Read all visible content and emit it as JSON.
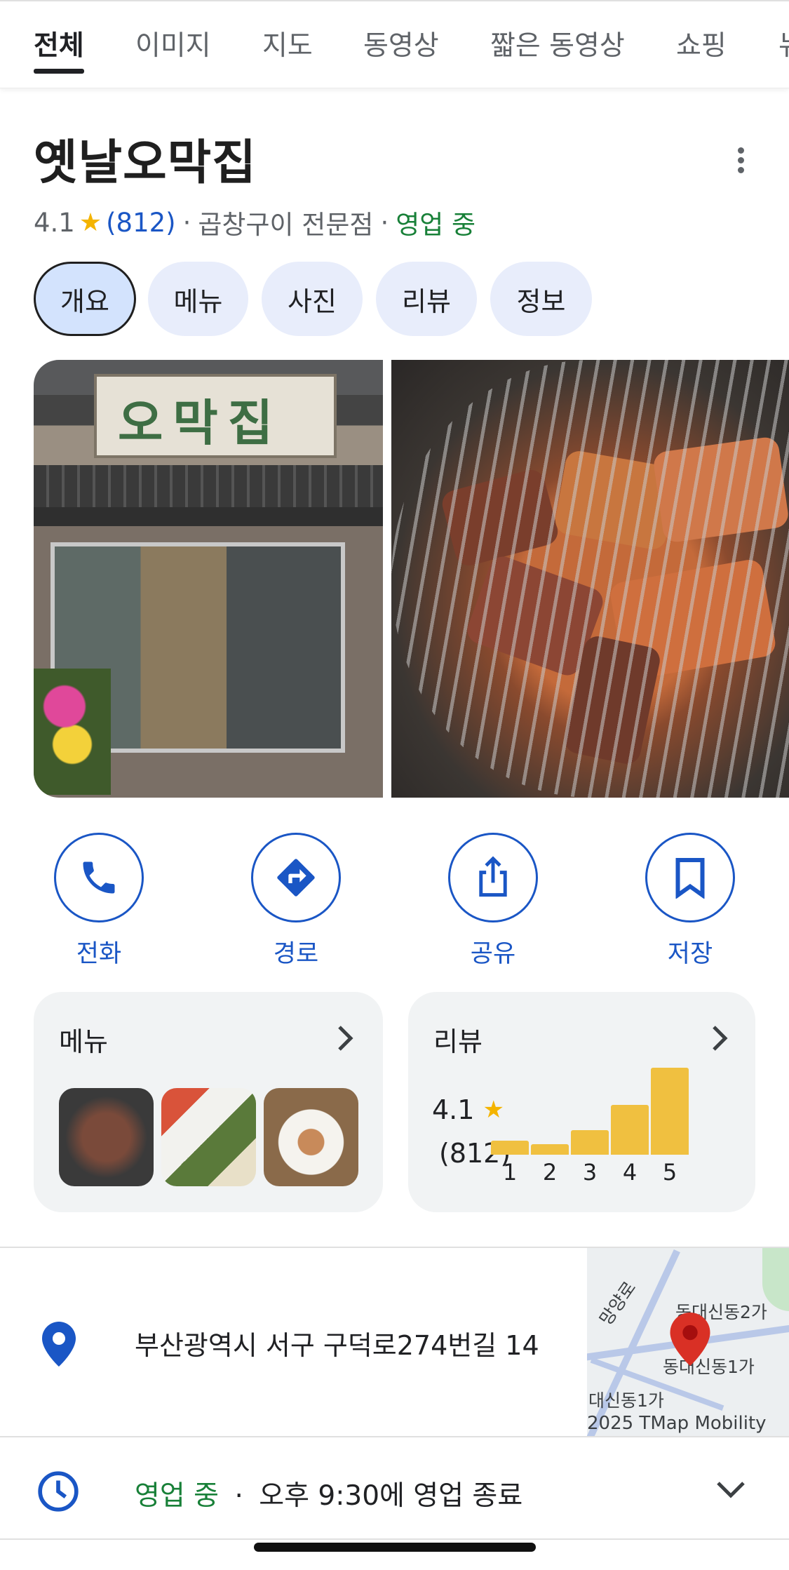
{
  "search_tabs": [
    "전체",
    "이미지",
    "지도",
    "동영상",
    "짧은 동영상",
    "쇼핑",
    "뉴"
  ],
  "place": {
    "name": "옛날오막집",
    "rating": "4.1",
    "rating_star": "★",
    "review_count": "(812)",
    "separator": "·",
    "category": "곱창구이 전문점",
    "status": "영업 중"
  },
  "chips": [
    "개요",
    "메뉴",
    "사진",
    "리뷰",
    "정보"
  ],
  "photos": {
    "store_sign": "오막집"
  },
  "actions": [
    {
      "label": "전화",
      "icon": "phone-icon"
    },
    {
      "label": "경로",
      "icon": "directions-icon"
    },
    {
      "label": "공유",
      "icon": "share-icon"
    },
    {
      "label": "저장",
      "icon": "bookmark-icon"
    }
  ],
  "menu_card": {
    "title": "메뉴"
  },
  "review_card": {
    "title": "리뷰",
    "rating": "4.1",
    "count": "(812)",
    "histogram": {
      "labels": [
        "1",
        "2",
        "3",
        "4",
        "5"
      ],
      "values": [
        0.16,
        0.12,
        0.28,
        0.57,
        1.0
      ]
    }
  },
  "address": {
    "text": "부산광역시 서구 구덕로274번길 14",
    "map_labels": [
      "망양로",
      "동대신동2가",
      "동대신동1가",
      "대신동1가",
      "2025 TMap Mobility"
    ]
  },
  "hours": {
    "status": "영업 중",
    "separator": "·",
    "closing": "오후 9:30에 영업 종료"
  },
  "colors": {
    "accent_blue": "#1a56c5",
    "open_green": "#188038",
    "star_yellow": "#f4b400",
    "chip_bg": "#e8edfb",
    "map_pin_red": "#d93025"
  }
}
